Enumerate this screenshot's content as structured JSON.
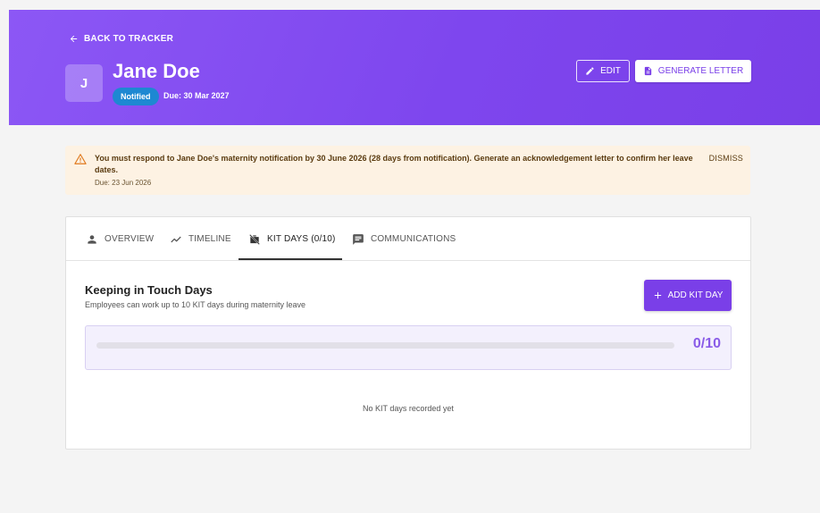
{
  "header": {
    "back_label": "BACK TO TRACKER",
    "avatar_initial": "J",
    "name": "Jane Doe",
    "status_badge": "Notified",
    "due_text": "Due: 30 Mar 2027",
    "edit_label": "EDIT",
    "generate_label": "GENERATE LETTER"
  },
  "alert": {
    "message": "You must respond to Jane Doe's maternity notification by 30 June 2026 (28 days from notification). Generate an acknowledgement letter to confirm her leave dates.",
    "due": "Due: 23 Jun 2026",
    "dismiss_label": "DISMISS"
  },
  "tabs": [
    {
      "label": "OVERVIEW",
      "icon": "person-icon"
    },
    {
      "label": "TIMELINE",
      "icon": "timeline-icon"
    },
    {
      "label": "KIT DAYS (0/10)",
      "icon": "briefcase-off-icon",
      "active": true
    },
    {
      "label": "COMMUNICATIONS",
      "icon": "chat-icon"
    }
  ],
  "kit": {
    "title": "Keeping in Touch Days",
    "subtitle": "Employees can work up to 10 KIT days during maternity leave",
    "add_label": "ADD KIT DAY",
    "used": 0,
    "max": 10,
    "count_text": "0/10",
    "empty_text": "No KIT days recorded yet"
  },
  "colors": {
    "primary": "#7a3fe8",
    "badge": "#1e88d2",
    "alert_bg": "#fdf2e3",
    "warning": "#e07a1f"
  }
}
